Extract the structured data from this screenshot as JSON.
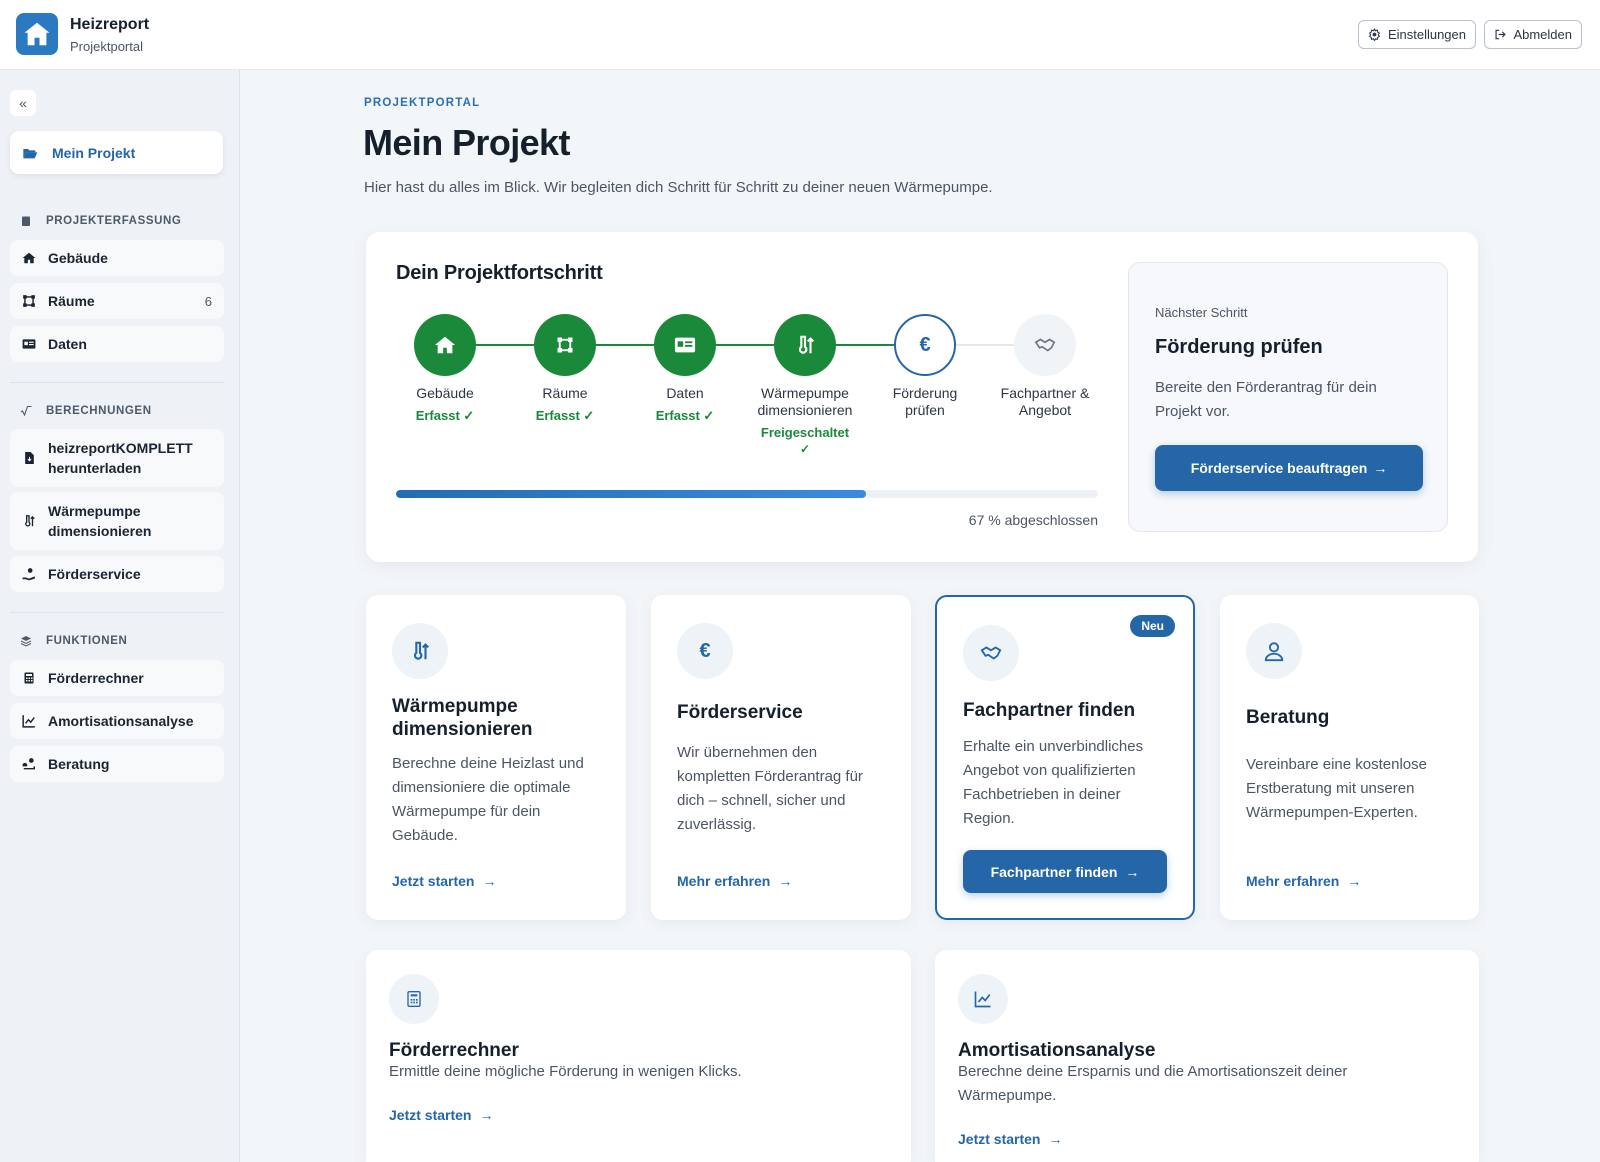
{
  "header": {
    "brand_title": "Heizreport",
    "brand_sub": "Projektportal",
    "settings_label": "Einstellungen",
    "logout_label": "Abmelden"
  },
  "sidebar": {
    "active_item": "Mein Projekt",
    "sections": [
      {
        "title": "PROJEKTERFASSUNG",
        "items": [
          {
            "label": "Gebäude",
            "icon": "home-icon"
          },
          {
            "label": "Räume",
            "icon": "room-icon",
            "badge": "6"
          },
          {
            "label": "Daten",
            "icon": "id-card-icon"
          }
        ]
      },
      {
        "title": "BERECHNUNGEN",
        "items": [
          {
            "label": "heizreportKOMPLETT herunterladen",
            "icon": "file-download-icon"
          },
          {
            "label": "Wärmepumpe dimensionieren",
            "icon": "heat-pump-icon"
          },
          {
            "label": "Förderservice",
            "icon": "hand-coin-icon"
          }
        ]
      },
      {
        "title": "FUNKTIONEN",
        "items": [
          {
            "label": "Förderrechner",
            "icon": "calculator-icon"
          },
          {
            "label": "Amortisationsanalyse",
            "icon": "chart-line-icon"
          },
          {
            "label": "Beratung",
            "icon": "consulting-icon"
          }
        ]
      }
    ]
  },
  "main": {
    "eyebrow": "PROJEKTPORTAL",
    "title": "Mein Projekt",
    "subtitle": "Hier hast du alles im Blick. Wir begleiten dich Schritt für Schritt zu deiner neuen Wärmepumpe.",
    "progress": {
      "title": "Dein Projektfortschritt",
      "steps": [
        {
          "label": "Gebäude",
          "status": "Erfasst ✓",
          "state": "done"
        },
        {
          "label": "Räume",
          "status": "Erfasst ✓",
          "state": "done"
        },
        {
          "label": "Daten",
          "status": "Erfasst ✓",
          "state": "done"
        },
        {
          "label": "Wärmepumpe dimensionieren",
          "status": "Freigeschaltet",
          "state": "done"
        },
        {
          "label": "Förderung prüfen",
          "status": "",
          "state": "current"
        },
        {
          "label": "Fachpartner & Angebot",
          "status": "",
          "state": "upcoming"
        }
      ],
      "percent": 0.67,
      "percent_text": "67 % abgeschlossen"
    },
    "next_step": {
      "eyebrow": "Nächster Schritt",
      "title": "Förderung prüfen",
      "description": "Bereite den Förderantrag für dein Projekt vor.",
      "button": "Förderservice beauftragen"
    },
    "cards": [
      {
        "title": "Wärmepumpe dimensionieren",
        "description": "Berechne deine Heizlast und dimensioniere die optimale Wärmepumpe für dein Gebäude.",
        "link": "Jetzt starten"
      },
      {
        "title": "Förderservice",
        "description": "Wir übernehmen den kompletten Förderantrag für dich – schnell, sicher und zuverlässig.",
        "link": "Mehr erfahren"
      },
      {
        "title": "Fachpartner finden",
        "description": "Erhalte ein unverbindliches Angebot von qualifizierten Fachbetrieben in deiner Region.",
        "button": "Fachpartner finden",
        "badge": "Neu"
      },
      {
        "title": "Beratung",
        "description": "Vereinbare eine kostenlose Erstberatung mit unseren Wärmepumpen-Experten.",
        "link": "Mehr erfahren"
      },
      {
        "title": "Förderrechner",
        "description": "Ermittle deine mögliche Förderung in wenigen Klicks.",
        "link": "Jetzt starten"
      },
      {
        "title": "Amortisationsanalyse",
        "description": "Berechne deine Ersparnis und die Amortisationszeit deiner Wärmepumpe.",
        "link": "Jetzt starten"
      }
    ]
  },
  "colors": {
    "accent": "#2466a8",
    "success": "#1a8a3a",
    "progress_light": "#3a8be0"
  }
}
